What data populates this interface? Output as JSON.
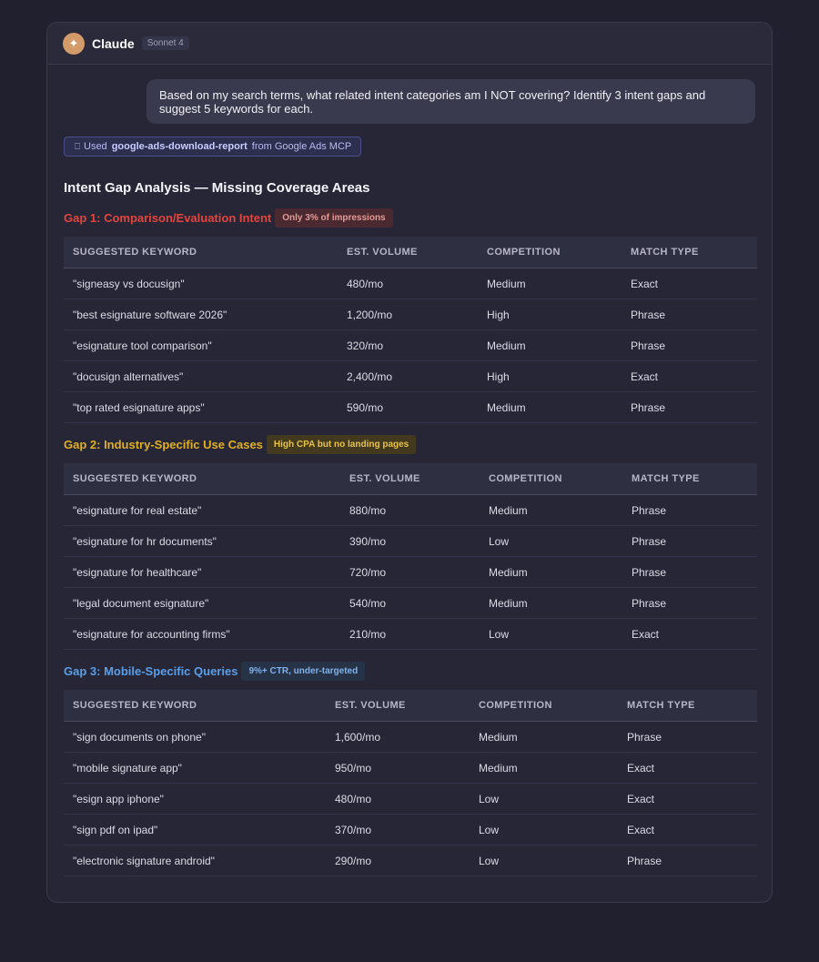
{
  "app": {
    "icon": "sparkle-icon",
    "name": "Claude",
    "model": "Sonnet 4"
  },
  "user_message": "Based on my search terms, what related intent categories am I NOT covering? Identify 3 intent gaps and suggest 5 keywords for each.",
  "tool": {
    "icon": "tool-icon",
    "prefix": "Used",
    "name": "google-ads-download-report",
    "suffix": "from Google Ads MCP"
  },
  "heading": "Intent Gap Analysis — Missing Coverage Areas",
  "columns": [
    "SUGGESTED KEYWORD",
    "EST. VOLUME",
    "COMPETITION",
    "MATCH TYPE"
  ],
  "gaps": [
    {
      "title": "Gap 1: Comparison/Evaluation Intent",
      "badge": "Only 3% of impressions",
      "color": "#e2453d",
      "rows": [
        [
          "\"signeasy vs docusign\"",
          "480/mo",
          "Medium",
          "Exact"
        ],
        [
          "\"best esignature software 2026\"",
          "1,200/mo",
          "High",
          "Phrase"
        ],
        [
          "\"esignature tool comparison\"",
          "320/mo",
          "Medium",
          "Phrase"
        ],
        [
          "\"docusign alternatives\"",
          "2,400/mo",
          "High",
          "Exact"
        ],
        [
          "\"top rated esignature apps\"",
          "590/mo",
          "Medium",
          "Phrase"
        ]
      ]
    },
    {
      "title": "Gap 2: Industry-Specific Use Cases",
      "badge": "High CPA but no landing pages",
      "color": "#e0b020",
      "rows": [
        [
          "\"esignature for real estate\"",
          "880/mo",
          "Medium",
          "Phrase"
        ],
        [
          "\"esignature for hr documents\"",
          "390/mo",
          "Low",
          "Phrase"
        ],
        [
          "\"esignature for healthcare\"",
          "720/mo",
          "Medium",
          "Phrase"
        ],
        [
          "\"legal document esignature\"",
          "540/mo",
          "Medium",
          "Phrase"
        ],
        [
          "\"esignature for accounting firms\"",
          "210/mo",
          "Low",
          "Exact"
        ]
      ]
    },
    {
      "title": "Gap 3: Mobile-Specific Queries",
      "badge": "9%+ CTR, under-targeted",
      "color": "#5b9ee8",
      "rows": [
        [
          "\"sign documents on phone\"",
          "1,600/mo",
          "Medium",
          "Phrase"
        ],
        [
          "\"mobile signature app\"",
          "950/mo",
          "Medium",
          "Exact"
        ],
        [
          "\"esign app iphone\"",
          "480/mo",
          "Low",
          "Exact"
        ],
        [
          "\"sign pdf on ipad\"",
          "370/mo",
          "Low",
          "Exact"
        ],
        [
          "\"electronic signature android\"",
          "290/mo",
          "Low",
          "Phrase"
        ]
      ]
    }
  ]
}
